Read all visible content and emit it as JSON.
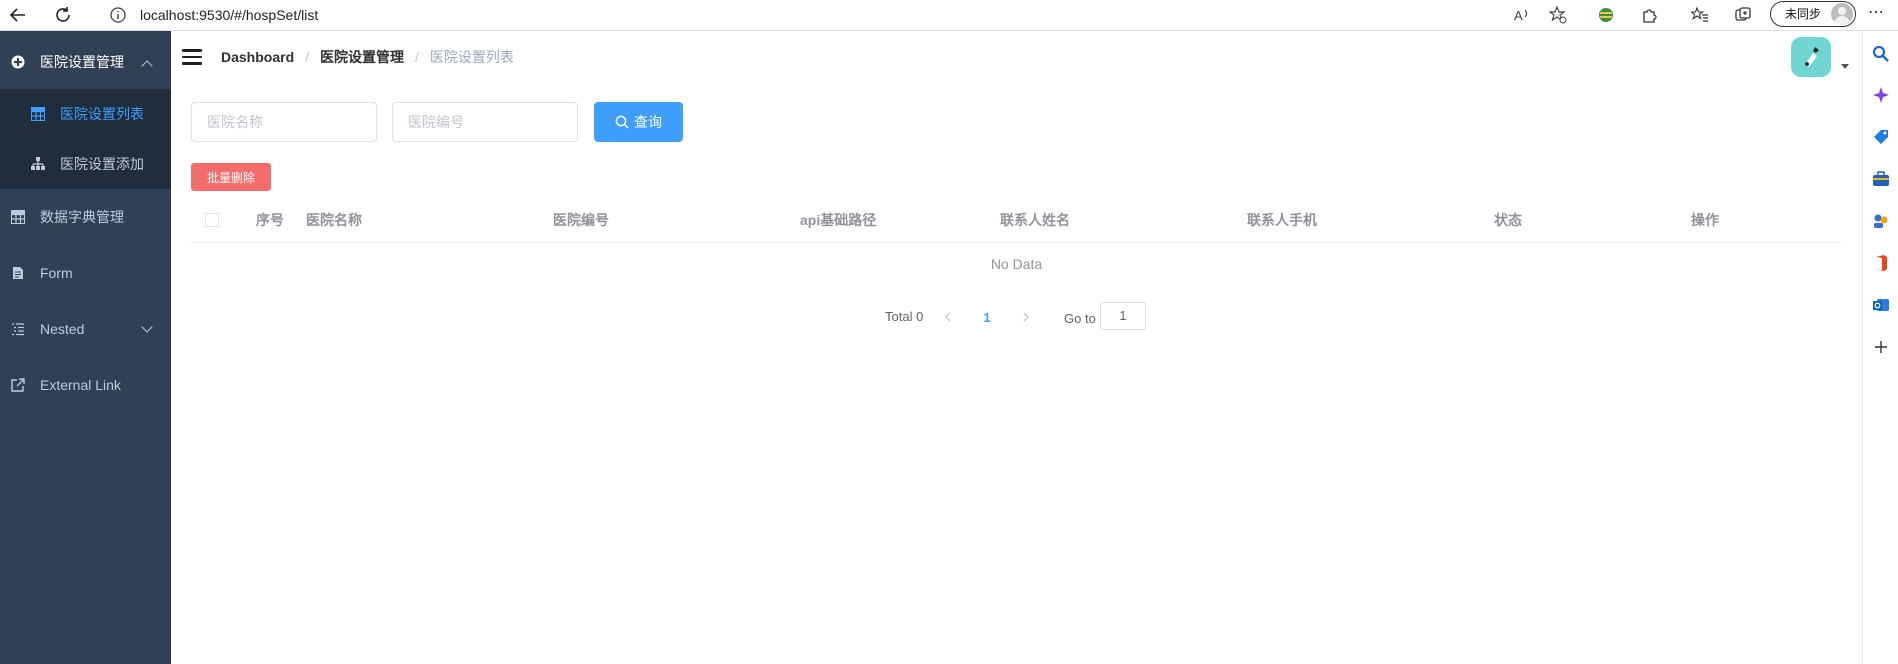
{
  "browser": {
    "url": "localhost:9530/#/hospSet/list",
    "sync_label": "未同步"
  },
  "sidebar": {
    "items": [
      {
        "label": "医院设置管理",
        "icon": "gear-circle-icon",
        "state": "open"
      },
      {
        "label": "医院设置列表",
        "icon": "table-icon",
        "state": "active"
      },
      {
        "label": "医院设置添加",
        "icon": "tree-icon",
        "state": "normal"
      },
      {
        "label": "数据字典管理",
        "icon": "table-icon",
        "state": "normal"
      },
      {
        "label": "Form",
        "icon": "form-icon",
        "state": "normal"
      },
      {
        "label": "Nested",
        "icon": "nested-icon",
        "state": "collapsed"
      },
      {
        "label": "External Link",
        "icon": "external-link-icon",
        "state": "normal"
      }
    ]
  },
  "navbar": {
    "breadcrumb": [
      "Dashboard",
      "医院设置管理",
      "医院设置列表"
    ]
  },
  "search": {
    "hosname_placeholder": "医院名称",
    "hoscode_placeholder": "医院编号",
    "query_label": "查询"
  },
  "toolbar": {
    "batch_delete_label": "批量删除"
  },
  "table": {
    "columns": [
      "序号",
      "医院名称",
      "医院编号",
      "api基础路径",
      "联系人姓名",
      "联系人手机",
      "状态",
      "操作"
    ],
    "empty_text": "No Data"
  },
  "pagination": {
    "total_label": "Total 0",
    "current_page": "1",
    "goto_label": "Go to",
    "goto_value": "1"
  },
  "colors": {
    "sidebar_bg": "#304156",
    "submenu_bg": "#1f2d3d",
    "primary": "#409eff",
    "danger": "#f56c6c"
  }
}
